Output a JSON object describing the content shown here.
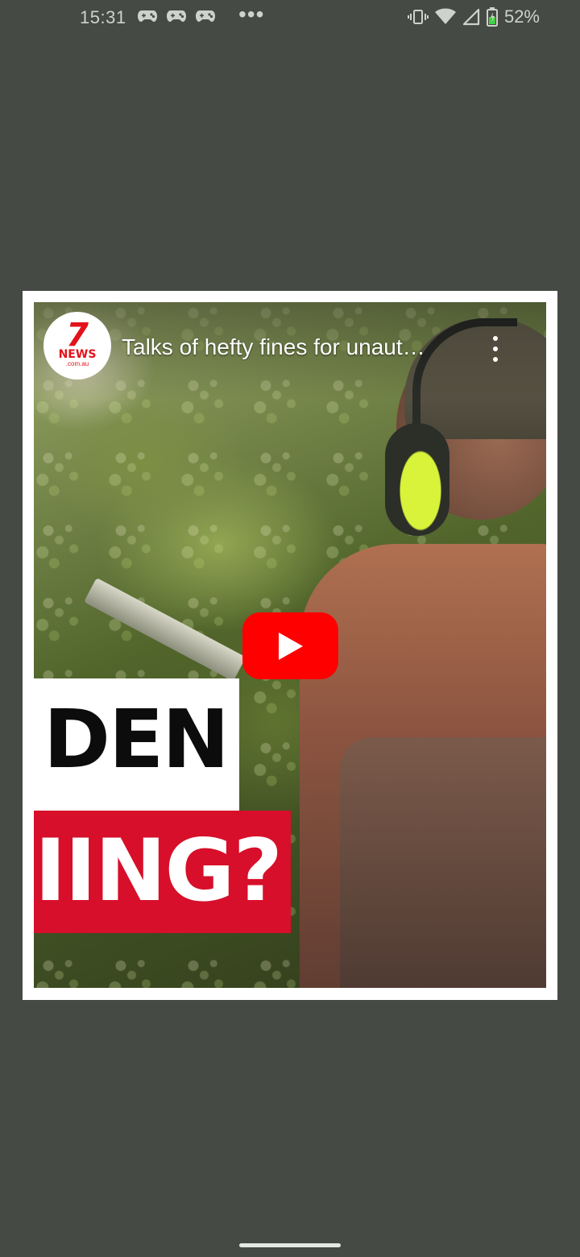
{
  "status_bar": {
    "time": "15:31",
    "notification_icons": [
      "game-controller-icon",
      "game-controller-icon",
      "game-controller-icon"
    ],
    "more_indicator": "•••",
    "battery_percent": "52%"
  },
  "video": {
    "channel": "7NEWS",
    "channel_logo_text": "7",
    "channel_logo_news": "NEWS",
    "channel_logo_sub": ".com.au",
    "title": "Talks of hefty fines for unaut…",
    "overlay_line1": "DEN",
    "overlay_line2": "IING?",
    "colors": {
      "banner_red": "#d70f2a",
      "play_button": "#ff0000",
      "logo_red": "#e3121b"
    }
  }
}
